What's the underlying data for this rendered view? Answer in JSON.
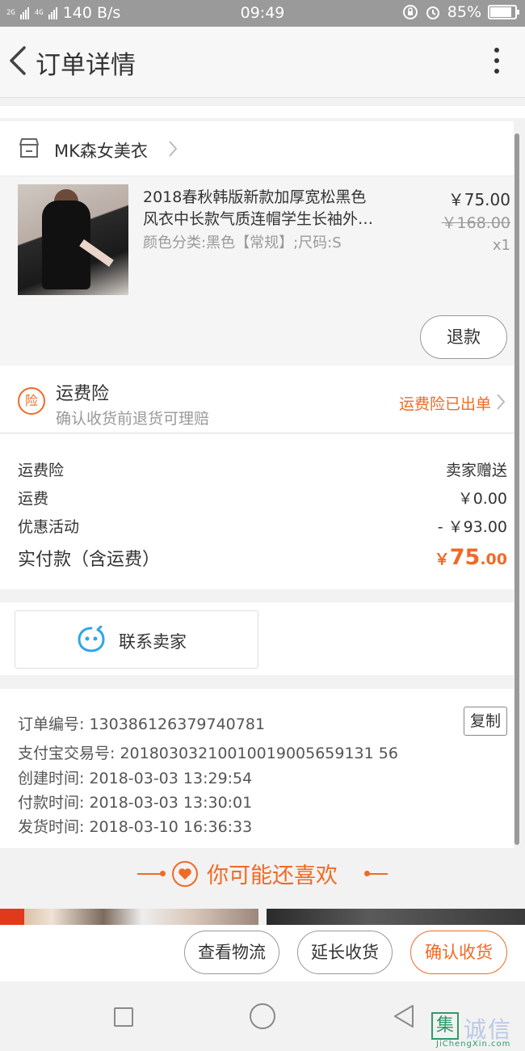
{
  "status_bar": {
    "net_speed": "140 B/s",
    "time": "09:49",
    "battery": "85%",
    "battery_level": 0.85,
    "sig1": "2G",
    "sig2": "4G"
  },
  "header": {
    "title": "订单详情"
  },
  "shop": {
    "name": "MK森女美衣"
  },
  "item": {
    "title_line1": "2018春秋韩版新款加厚宽松黑色",
    "title_line2": "风衣中长款气质连帽学生长袖外…",
    "spec": "颜色分类:黑色【常规】;尺码:S",
    "price": "￥75.00",
    "original_price": "￥168.00",
    "quantity": "x1",
    "refund_label": "退款"
  },
  "insurance": {
    "icon_char": "险",
    "title": "运费险",
    "subtitle": "确认收货前退货可理赔",
    "status": "运费险已出单"
  },
  "costs": [
    {
      "label": "运费险",
      "value": "卖家赠送"
    },
    {
      "label": "运费",
      "value": "￥0.00"
    },
    {
      "label": "优惠活动",
      "value": "- ￥93.00"
    }
  ],
  "total": {
    "label": "实付款（含运费）",
    "currency": "￥",
    "integer": "75",
    "decimal": ".00"
  },
  "contact": {
    "label": "联系卖家"
  },
  "order_info": {
    "order_no": "订单编号: 130386126379740781",
    "alipay_no": "支付宝交易号: 20180303210010019005659131 56",
    "created": "创建时间: 2018-03-03 13:29:54",
    "paid": "付款时间: 2018-03-03 13:30:01",
    "shipped": "发货时间: 2018-03-10 16:36:33",
    "copy_label": "复制"
  },
  "recommend": {
    "title": "你可能还喜欢"
  },
  "actions": {
    "logistics": "查看物流",
    "extend": "延长收货",
    "confirm": "确认收货"
  },
  "watermark": {
    "glyph": "集",
    "text": "诚信",
    "url": "JiChengXin.com"
  },
  "colors": {
    "accent": "#f06a25",
    "status_bar": "#9a9a9a",
    "contact_icon": "#2fa6e8"
  }
}
